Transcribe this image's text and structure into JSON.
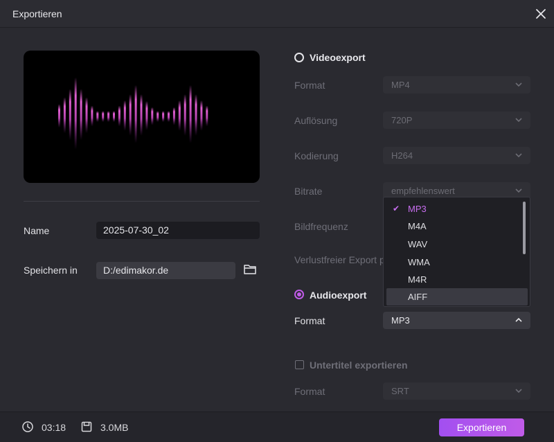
{
  "window": {
    "title": "Exportieren"
  },
  "left": {
    "name_label": "Name",
    "name_value": "2025-07-30_02",
    "save_label": "Speichern in",
    "save_path": "D:/edimakor.de"
  },
  "video": {
    "title": "Videoexport",
    "selected": false,
    "fields": [
      {
        "label": "Format",
        "value": "MP4"
      },
      {
        "label": "Auflösung",
        "value": "720P"
      },
      {
        "label": "Kodierung",
        "value": "H264"
      },
      {
        "label": "Bitrate",
        "value": "empfehlenswert"
      },
      {
        "label": "Bildfrequenz",
        "value": ""
      },
      {
        "label": "Verlustfreier Export p",
        "value": ""
      }
    ]
  },
  "audio": {
    "title": "Audioexport",
    "selected": true,
    "format_label": "Format",
    "format_value": "MP3",
    "dropdown_options": [
      "MP3",
      "M4A",
      "WAV",
      "WMA",
      "M4R",
      "AIFF"
    ],
    "dropdown_selected": "MP3",
    "dropdown_hover": "AIFF"
  },
  "subtitle": {
    "title": "Untertitel exportieren",
    "checked": false,
    "format_label": "Format",
    "format_value": "SRT"
  },
  "footer": {
    "duration": "03:18",
    "size": "3.0MB",
    "export_label": "Exportieren"
  },
  "colors": {
    "accent": "#c05be8",
    "button": "#a24ff0",
    "wave": "#d05ec8"
  }
}
